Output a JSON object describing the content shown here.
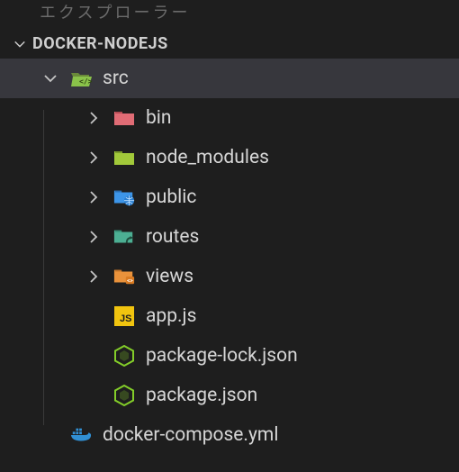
{
  "top_label": "エクスプローラー",
  "section": {
    "title": "DOCKER-NODEJS"
  },
  "tree": {
    "src": {
      "label": "src"
    },
    "bin": {
      "label": "bin"
    },
    "node_modules": {
      "label": "node_modules"
    },
    "public": {
      "label": "public"
    },
    "routes": {
      "label": "routes"
    },
    "views": {
      "label": "views"
    },
    "appjs": {
      "label": "app.js"
    },
    "pkglock": {
      "label": "package-lock.json"
    },
    "pkg": {
      "label": "package.json"
    },
    "compose": {
      "label": "docker-compose.yml"
    }
  },
  "colors": {
    "folder_green": "#8ac24a",
    "folder_red": "#e06c75",
    "folder_blue": "#3d95e8",
    "folder_teal": "#4caf93",
    "folder_orange": "#e9923b",
    "js_yellow": "#f1c40f",
    "node_green": "#83cd29",
    "docker_blue": "#3190d4"
  }
}
